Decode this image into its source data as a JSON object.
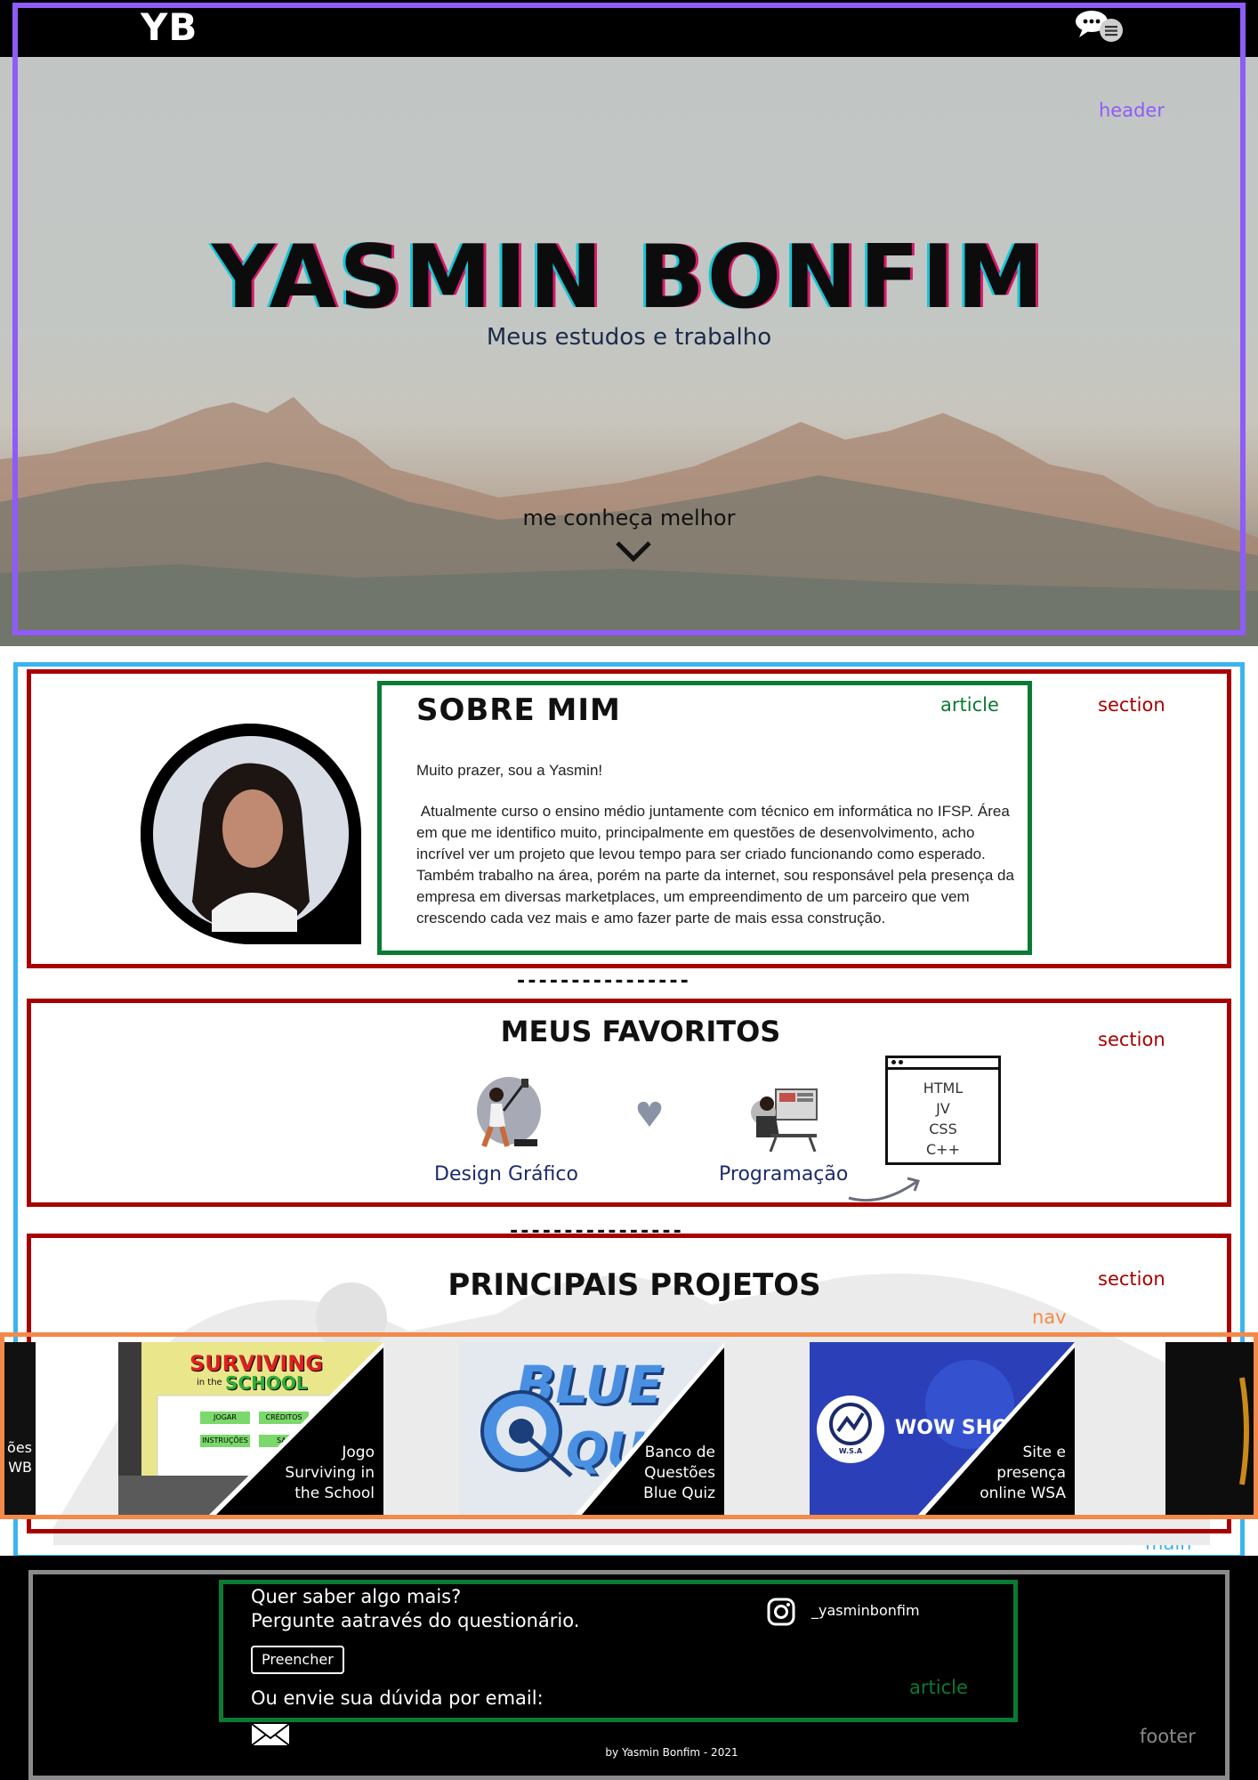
{
  "topbar": {
    "logo": "YB",
    "menu_icon": "chat-menu-icon"
  },
  "hero": {
    "title": "YASMIN BONFIM",
    "subtitle": "Meus estudos e trabalho",
    "cta": "me conheça melhor",
    "cta_icon": "chevron-down-icon"
  },
  "about": {
    "title": "SOBRE MIM",
    "greeting": "Muito prazer, sou a Yasmin!",
    "text": " Atualmente curso o ensino médio juntamente com técnico em informática no IFSP. Área em que me identifico muito, principalmente em questões de desenvolvimento, acho incrível ver um projeto que levou tempo para ser criado funcionando como esperado. Também trabalho na área, porém na parte da internet, sou responsável pela presença da empresa em diversas marketplaces, um empreendimento de um parceiro que vem crescendo cada vez mais e amo fazer parte de mais essa construção."
  },
  "divider": "----------------",
  "divider2": "----------------",
  "favorites": {
    "title": "MEUS FAVORITOS",
    "items": [
      "Design Gráfico",
      "Programação"
    ],
    "code_lines": [
      "HTML",
      "JV",
      "CSS",
      "C++"
    ]
  },
  "projects": {
    "title": "PRINCIPAIS PROJETOS",
    "left_partial": "ões\nWB",
    "cards": [
      {
        "caption": "Jogo\nSurviving in\nthe School",
        "logo_line1": "SURVIVING",
        "logo_line2": "in the",
        "logo_line3": "SCHOOL",
        "btn1": "JOGAR",
        "btn2": "CRÉDITOS",
        "btn3": "INSTRUÇÕES",
        "btn4": "SAI"
      },
      {
        "caption": "Banco de\nQuestões\nBlue Quiz",
        "logo_line1": "BLUE",
        "logo_line2": "QUIZ"
      },
      {
        "caption": "Site e\npresença\nonline WSA",
        "brand": "WOW SHOP A",
        "badge": "W.S.A"
      }
    ]
  },
  "footer": {
    "ask_line1": "Quer saber algo mais?",
    "ask_line2": "Pergunte aatravés do questionário.",
    "fill_button": "Preencher",
    "email_text": "Ou envie sua dúvida por email:",
    "instagram_handle": "_yasminbonfim",
    "credit": "by Yasmin Bonfim - 2021"
  },
  "outline_labels": {
    "header": "header",
    "section": "section",
    "article": "article",
    "nav": "nav",
    "main": "main",
    "footer": "footer"
  },
  "colors": {
    "header_outline": "#8e5cf7",
    "main_outline": "#3bb4f0",
    "section_outline": "#a80000",
    "article_outline": "#0a7a34",
    "nav_outline": "#f4894a",
    "footer_outline": "#8a8a8a"
  }
}
